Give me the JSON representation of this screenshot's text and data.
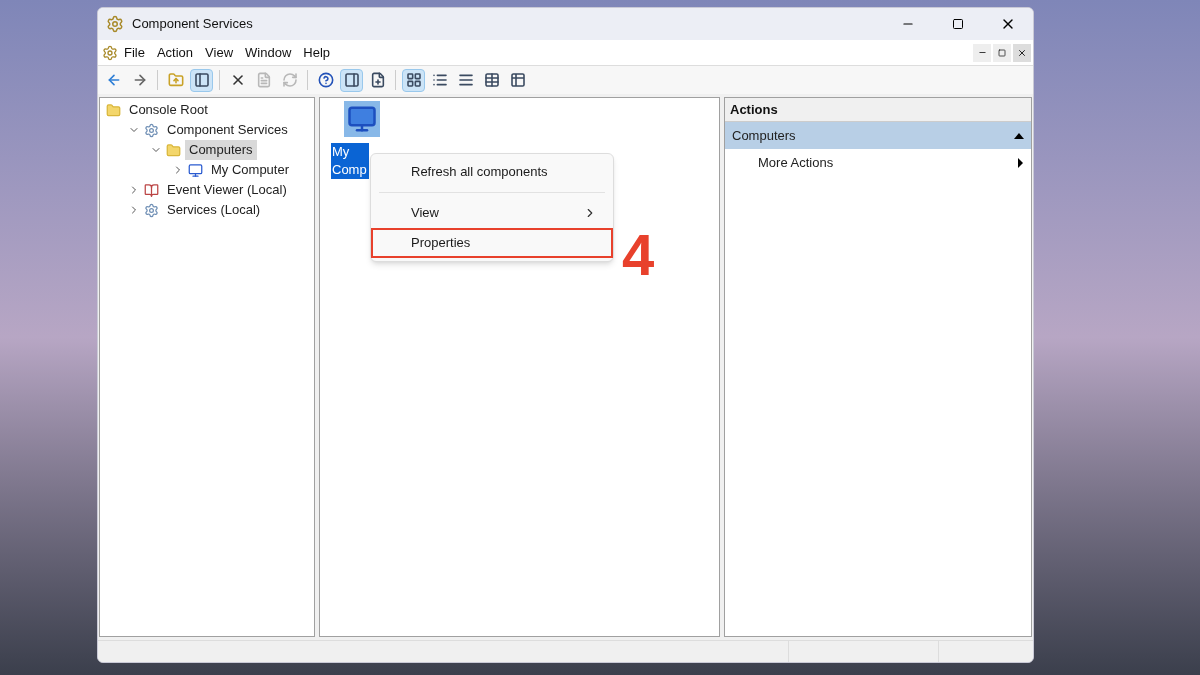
{
  "window": {
    "title": "Component Services"
  },
  "menu_bar": [
    "File",
    "Action",
    "View",
    "Window",
    "Help"
  ],
  "toolbar": [
    {
      "kind": "back",
      "pressed": false,
      "disabled": false
    },
    {
      "kind": "forward",
      "pressed": false,
      "disabled": false
    },
    {
      "kind": "sep"
    },
    {
      "kind": "up",
      "pressed": false,
      "disabled": false
    },
    {
      "kind": "tree",
      "pressed": true,
      "disabled": false
    },
    {
      "kind": "sep"
    },
    {
      "kind": "delete",
      "pressed": false,
      "disabled": false
    },
    {
      "kind": "properties",
      "pressed": false,
      "disabled": true
    },
    {
      "kind": "refresh",
      "pressed": false,
      "disabled": true
    },
    {
      "kind": "sep"
    },
    {
      "kind": "help",
      "pressed": false,
      "disabled": false
    },
    {
      "kind": "actionpane",
      "pressed": true,
      "disabled": false
    },
    {
      "kind": "new",
      "pressed": false,
      "disabled": false
    },
    {
      "kind": "sep"
    },
    {
      "kind": "largeicons",
      "pressed": true,
      "disabled": false
    },
    {
      "kind": "smallicons",
      "pressed": false,
      "disabled": false
    },
    {
      "kind": "list",
      "pressed": false,
      "disabled": false
    },
    {
      "kind": "detail",
      "pressed": false,
      "disabled": false
    },
    {
      "kind": "custom",
      "pressed": false,
      "disabled": false
    }
  ],
  "tree": [
    {
      "label": "Console Root",
      "kind": "folder",
      "selected": false,
      "children": [
        {
          "label": "Component Services",
          "kind": "gear",
          "selected": false,
          "expanded": true,
          "children": [
            {
              "label": "Computers",
              "kind": "folder",
              "selected": true,
              "expanded": true,
              "children": [
                {
                  "label": "My Computer",
                  "kind": "computer",
                  "selected": false,
                  "expanded": false
                }
              ]
            }
          ]
        },
        {
          "label": "Event Viewer (Local)",
          "kind": "log",
          "selected": false,
          "expanded": false
        },
        {
          "label": "Services (Local)",
          "kind": "gear",
          "selected": false,
          "expanded": false
        }
      ]
    }
  ],
  "content": {
    "items": [
      {
        "label": "My Comp",
        "selected": true
      }
    ]
  },
  "context_menu": [
    {
      "label": "Refresh all components",
      "submenu": false,
      "highlighted": false
    },
    {
      "kind": "sep"
    },
    {
      "label": "View",
      "submenu": true,
      "highlighted": false
    },
    {
      "label": "Properties",
      "submenu": false,
      "highlighted": true
    }
  ],
  "annotation": {
    "label": "4"
  },
  "actions": {
    "title": "Actions",
    "sections": [
      {
        "label": "Computers",
        "expanded": true,
        "items": [
          {
            "label": "More Actions",
            "submenu": true
          }
        ]
      }
    ]
  }
}
